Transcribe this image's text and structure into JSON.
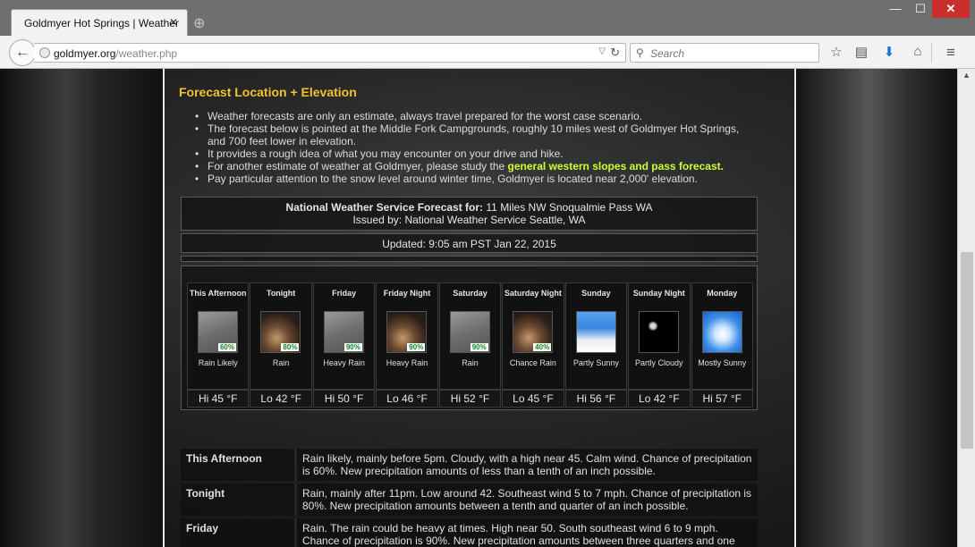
{
  "browser": {
    "tab_title": "Goldmyer Hot Springs | Weather",
    "url_host": "goldmyer.org",
    "url_path": "/weather.php",
    "search_placeholder": "Search"
  },
  "page": {
    "heading": "Forecast Location + Elevation",
    "notes": [
      "Weather forecasts are only an estimate, always travel prepared for the worst case scenario.",
      "The forecast below is pointed at the Middle Fork Campgrounds, roughly 10 miles west of Goldmyer Hot Springs, and 700 feet lower in elevation.",
      "It provides a rough idea of what you may encounter on your drive and hike."
    ],
    "note4_prefix": "For another estimate of weather at Goldmyer, please study the ",
    "note4_link": "general western slopes and pass forecast.",
    "note5": "Pay particular attention to the snow level around winter time, Goldmyer is located near 2,000' elevation.",
    "nws_label": "National Weather Service Forecast for:",
    "nws_location": " 11 Miles NW Snoqualmie Pass WA",
    "issued": "Issued by: National Weather Service Seattle, WA",
    "updated": "Updated: 9:05 am PST Jan 22, 2015"
  },
  "forecast": [
    {
      "name": "This Afternoon",
      "icon": "rain-icon",
      "img": "img-rain",
      "pop": "60%",
      "desc": "Rain Likely",
      "temp": "Hi 45 °F"
    },
    {
      "name": "Tonight",
      "icon": "night-rain-icon",
      "img": "img-nrain",
      "pop": "80%",
      "desc": "Rain",
      "temp": "Lo 42 °F"
    },
    {
      "name": "Friday",
      "icon": "rain-icon",
      "img": "img-rain",
      "pop": "90%",
      "desc": "Heavy Rain",
      "temp": "Hi 50 °F"
    },
    {
      "name": "Friday Night",
      "icon": "night-rain-icon",
      "img": "img-nrain",
      "pop": "90%",
      "desc": "Heavy Rain",
      "temp": "Lo 46 °F"
    },
    {
      "name": "Saturday",
      "icon": "rain-icon",
      "img": "img-rain",
      "pop": "90%",
      "desc": "Rain",
      "temp": "Hi 52 °F"
    },
    {
      "name": "Saturday Night",
      "icon": "night-rain-icon",
      "img": "img-nrain",
      "pop": "40%",
      "desc": "Chance Rain",
      "temp": "Lo 45 °F"
    },
    {
      "name": "Sunday",
      "icon": "partly-sunny-icon",
      "img": "img-pcloud",
      "pop": "",
      "desc": "Partly Sunny",
      "temp": "Hi 56 °F"
    },
    {
      "name": "Sunday Night",
      "icon": "partly-cloudy-night-icon",
      "img": "img-night",
      "pop": "",
      "desc": "Partly Cloudy",
      "temp": "Lo 42 °F"
    },
    {
      "name": "Monday",
      "icon": "mostly-sunny-icon",
      "img": "img-sun",
      "pop": "",
      "desc": "Mostly Sunny",
      "temp": "Hi 57 °F"
    }
  ],
  "details": [
    {
      "name": "This Afternoon",
      "text": "Rain likely, mainly before 5pm. Cloudy, with a high near 45. Calm wind. Chance of precipitation is 60%. New precipitation amounts of less than a tenth of an inch possible."
    },
    {
      "name": "Tonight",
      "text": "Rain, mainly after 11pm. Low around 42. Southeast wind 5 to 7 mph. Chance of precipitation is 80%. New precipitation amounts between a tenth and quarter of an inch possible."
    },
    {
      "name": "Friday",
      "text": "Rain. The rain could be heavy at times. High near 50. South southeast wind 6 to 9 mph. Chance of precipitation is 90%. New precipitation amounts between three quarters and one inch"
    }
  ]
}
